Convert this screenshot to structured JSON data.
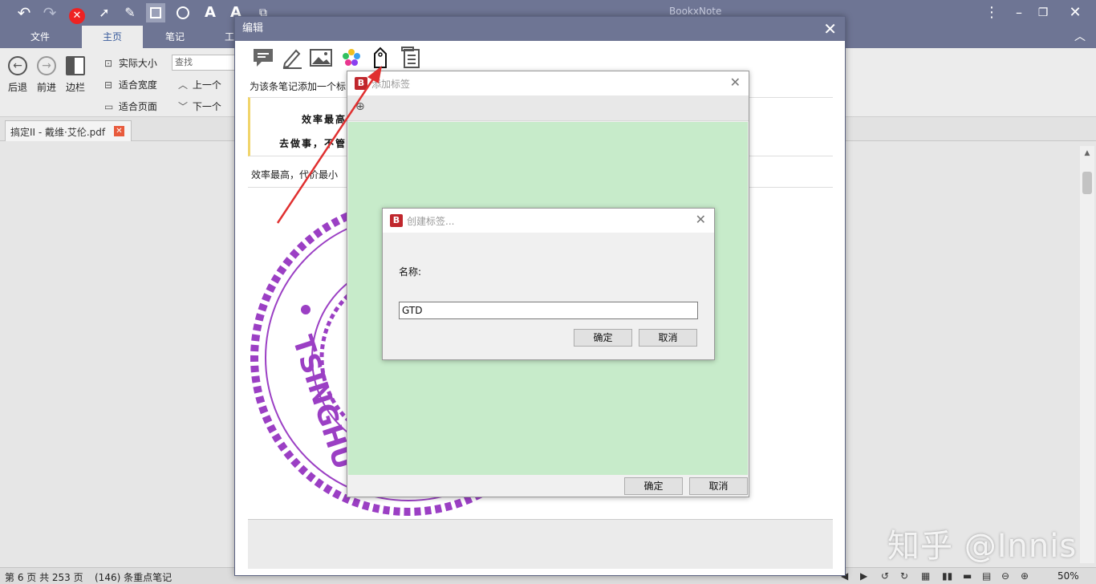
{
  "app": {
    "title": "BookxNote"
  },
  "menu": {
    "tabs": [
      "文件",
      "主页",
      "笔记",
      "工"
    ]
  },
  "ribbon": {
    "back_label": "后退",
    "forward_label": "前进",
    "sidebar_label": "边栏",
    "actual_size": "实际大小",
    "fit_width": "适合宽度",
    "fit_page": "适合页面",
    "search_placeholder": "查找",
    "prev_label": "上一个",
    "next_label": "下一个"
  },
  "doc_tab": {
    "label": "搞定II - 戴维·艾伦.pdf"
  },
  "edit_dialog": {
    "title": "编辑",
    "tag_hint": "为该条笔记添加一个标",
    "quote_line1": "效率最高",
    "quote_line2": "去做事，不管",
    "note_text": "效率最高，代价最小",
    "seal_text": "TSINGHU"
  },
  "tag_dialog": {
    "title": "添加标签",
    "ok_label": "确定",
    "cancel_label": "取消",
    "area_color": "#c7ebca"
  },
  "create_dialog": {
    "title": "创建标签...",
    "name_label": "名称:",
    "name_value": "GTD",
    "ok_label": "确定",
    "cancel_label": "取消"
  },
  "status": {
    "page_info": "第 6 页 共 253 页",
    "notes_info": "(146) 条重点笔记",
    "zoom": "50%"
  },
  "watermark": "知乎 @Innis",
  "colors": {
    "title_bar": "#6e7594",
    "annotation_arrow": "#e03030",
    "seal": "#9b3fc4"
  }
}
